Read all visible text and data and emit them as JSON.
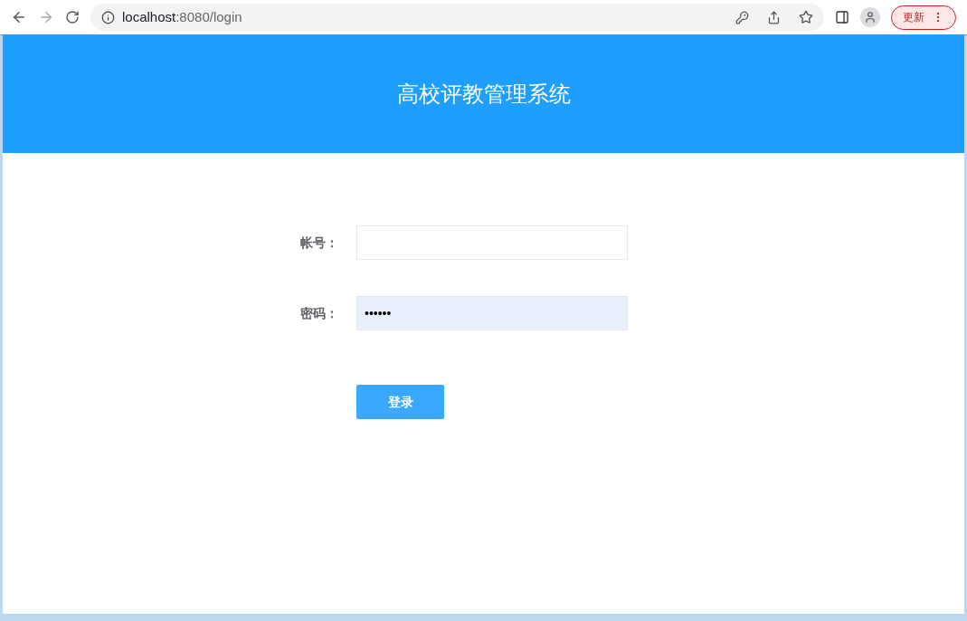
{
  "browser": {
    "back_disabled": false,
    "forward_disabled": true,
    "url": {
      "host": "localhost",
      "path": ":8080/login"
    },
    "update_button": "更新"
  },
  "header": {
    "title": "高校评教管理系统"
  },
  "form": {
    "fields": [
      {
        "label": "帐号：",
        "autofilled": false
      },
      {
        "label": "密码：",
        "value": "••••••",
        "autofilled": true
      }
    ],
    "submit": "登录"
  }
}
